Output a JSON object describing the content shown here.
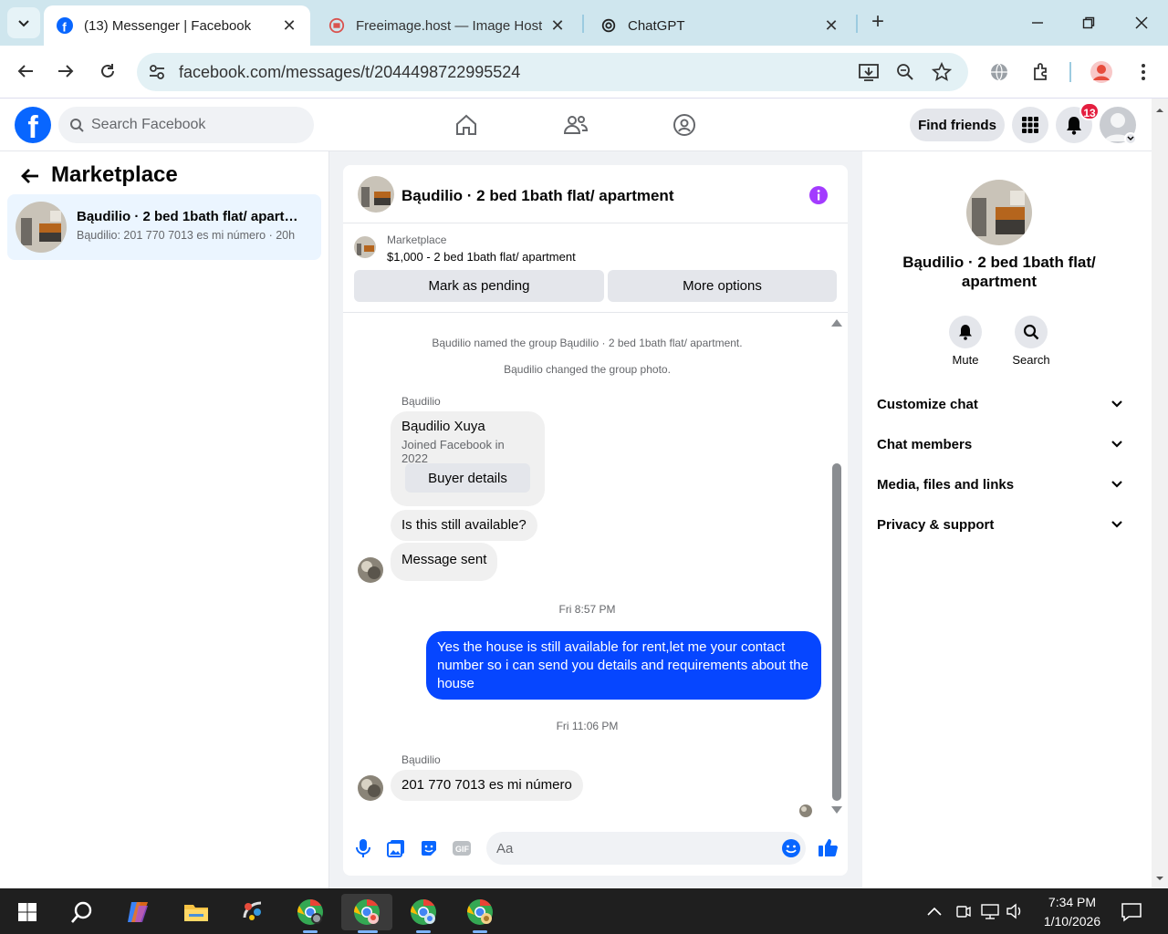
{
  "browser": {
    "tabs": [
      {
        "title": "(13) Messenger | Facebook",
        "active": true
      },
      {
        "title": "Freeimage.host — Image Hosting",
        "active": false
      },
      {
        "title": "ChatGPT",
        "active": false
      }
    ],
    "url": "facebook.com/messages/t/2044498722995524"
  },
  "fb": {
    "search_placeholder": "Search Facebook",
    "find_friends": "Find friends",
    "notification_count": "13"
  },
  "sidebar": {
    "title": "Marketplace",
    "conversation": {
      "title": "Bąudilio · 2 bed 1bath flat/ apartment",
      "preview": "Bąudilio: 201 770 7013 es mi número",
      "time": "20h"
    }
  },
  "chat": {
    "title": "Bąudilio · 2 bed 1bath flat/ apartment",
    "marketplace_label": "Marketplace",
    "listing": "$1,000 - 2 bed 1bath flat/ apartment",
    "mark_pending": "Mark as pending",
    "more_options": "More options",
    "messages": {
      "sys1": "Bąudilio named the group Bąudilio · 2 bed 1bath flat/ apartment.",
      "sys2": "Bąudilio changed the group photo.",
      "sender1": "Bąudilio",
      "card_name": "Bąudilio Xuya",
      "card_sub": "Joined Facebook in 2022",
      "card_button": "Buyer details",
      "msg1": "Is this still available?",
      "msg2": "Message sent",
      "time1": "Fri 8:57 PM",
      "mine1": "Yes the house is still available for rent,let me your contact number so i can send you details and requirements about the house",
      "time2": "Fri 11:06 PM",
      "sender2": "Bąudilio",
      "msg3": "201 770 7013 es mi número"
    },
    "composer_placeholder": "Aa"
  },
  "panel": {
    "title": "Bąudilio · 2 bed 1bath flat/ apartment",
    "mute": "Mute",
    "search": "Search",
    "sections": [
      "Customize chat",
      "Chat members",
      "Media, files and links",
      "Privacy & support"
    ]
  },
  "taskbar": {
    "time": "7:34 PM",
    "date": "1/10/2026"
  },
  "colors": {
    "fb_blue": "#0866ff",
    "my_bubble": "#0646ff",
    "info_purple": "#a33bff",
    "badge_red": "#e41e3f"
  }
}
